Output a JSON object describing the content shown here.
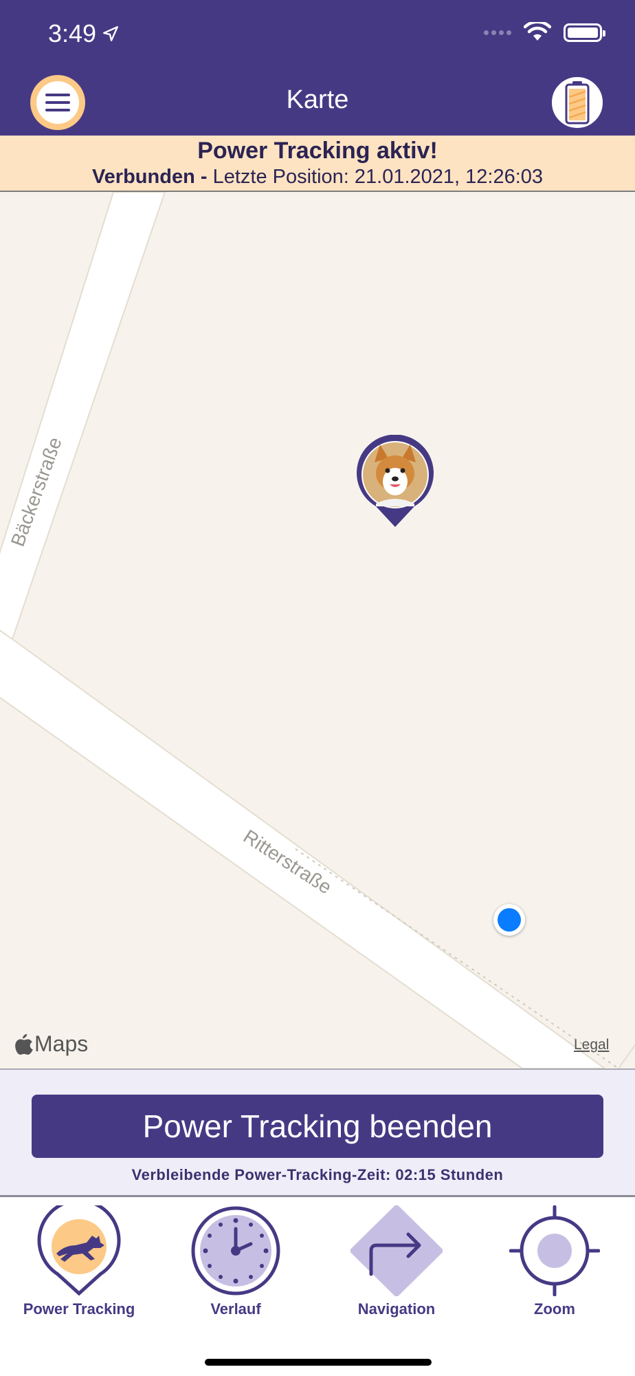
{
  "status_bar": {
    "time": "3:49"
  },
  "header": {
    "title": "Karte"
  },
  "banner": {
    "title": "Power Tracking aktiv!",
    "connection": "Verbunden -",
    "last_position": "Letzte Position: 21.01.2021, 12:26:03"
  },
  "map": {
    "streets": [
      "Bäckerstraße",
      "Ritterstraße"
    ],
    "attribution": "Maps",
    "legal": "Legal"
  },
  "action": {
    "stop_button": "Power Tracking beenden",
    "remaining_time": "Verbleibende Power-Tracking-Zeit: 02:15  Stunden"
  },
  "tabs": [
    {
      "label": "Power Tracking",
      "icon": "dog-running-icon"
    },
    {
      "label": "Verlauf",
      "icon": "clock-icon"
    },
    {
      "label": "Navigation",
      "icon": "directions-icon"
    },
    {
      "label": "Zoom",
      "icon": "crosshair-icon"
    }
  ],
  "colors": {
    "primary": "#463984",
    "accent": "#fdc987",
    "banner": "#fde3c2",
    "map_bg": "#f7f3ec",
    "user_location": "#0a7cff"
  }
}
